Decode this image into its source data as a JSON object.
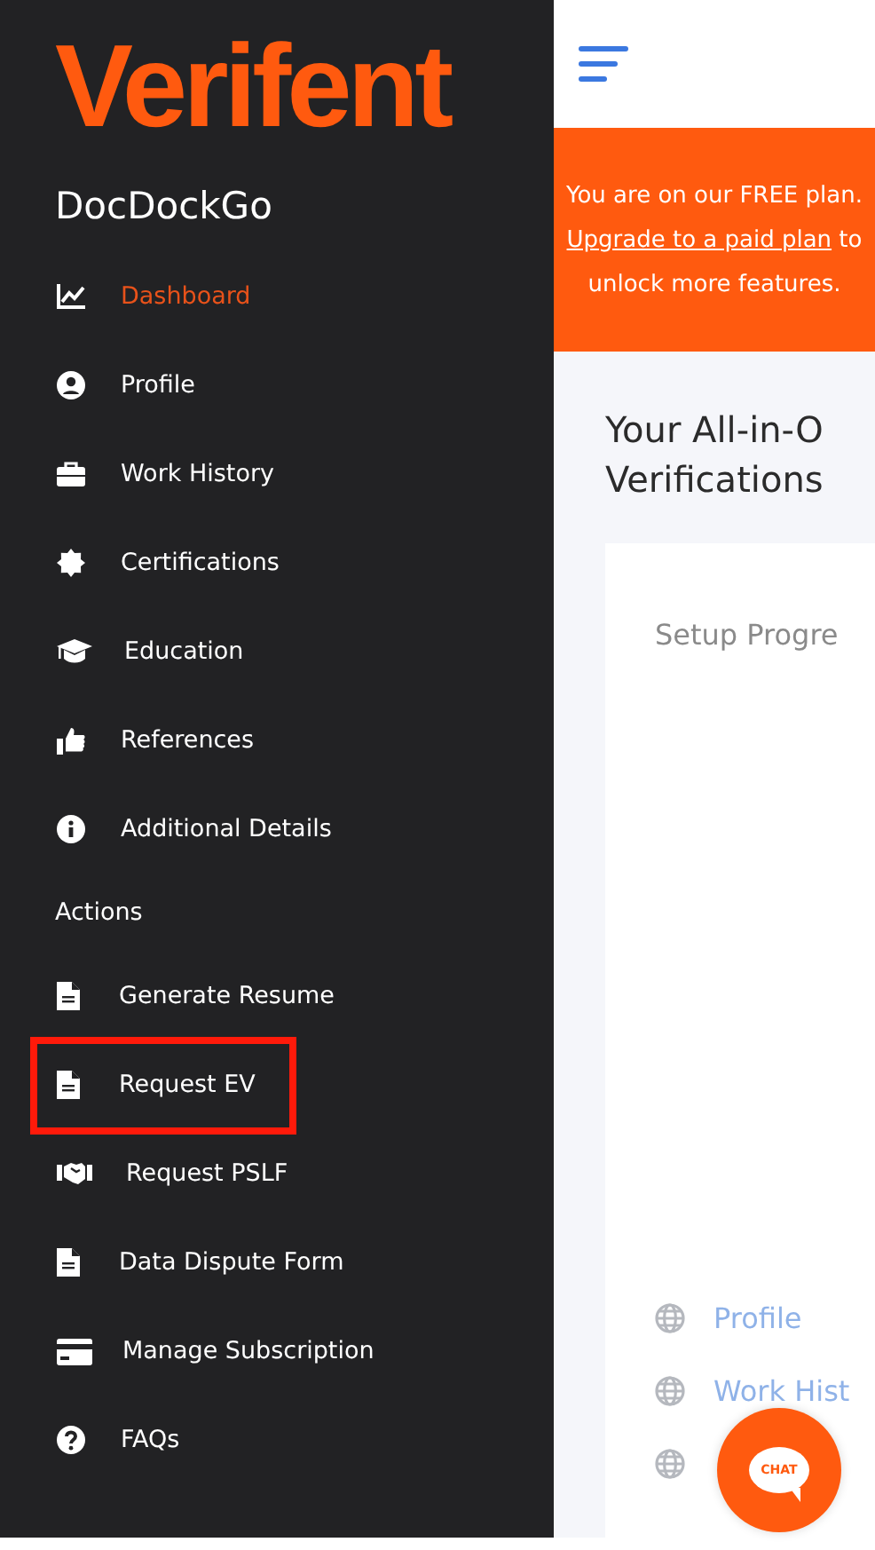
{
  "sidebar": {
    "logo": "Verifent",
    "account_name": "DocDockGo",
    "nav_items": [
      {
        "label": "Dashboard",
        "selected": true
      },
      {
        "label": "Profile",
        "selected": false
      },
      {
        "label": "Work History",
        "selected": false
      },
      {
        "label": "Certifications",
        "selected": false
      },
      {
        "label": "Education",
        "selected": false
      },
      {
        "label": "References",
        "selected": false
      },
      {
        "label": "Additional Details",
        "selected": false
      }
    ],
    "actions_heading": "Actions",
    "action_items": [
      {
        "label": "Generate Resume",
        "highlighted": false
      },
      {
        "label": "Request EV",
        "highlighted": true
      },
      {
        "label": "Request PSLF",
        "highlighted": false
      },
      {
        "label": "Data Dispute Form",
        "highlighted": false
      },
      {
        "label": "Manage Subscription",
        "highlighted": false
      },
      {
        "label": "FAQs",
        "highlighted": false
      }
    ]
  },
  "banner": {
    "text_before": "You are on our FREE plan.",
    "link": "Upgrade to a paid plan",
    "text_after": "to unlock more features."
  },
  "heading_lines": [
    "Your All-in-O",
    "Verifications"
  ],
  "setup_card": {
    "title": "Setup Progre",
    "items": [
      {
        "kind": "step",
        "label": "Profile"
      },
      {
        "kind": "step",
        "label": "Work Hist"
      },
      {
        "kind": "icon"
      }
    ]
  },
  "chat_button": {
    "label": "CHAT"
  }
}
